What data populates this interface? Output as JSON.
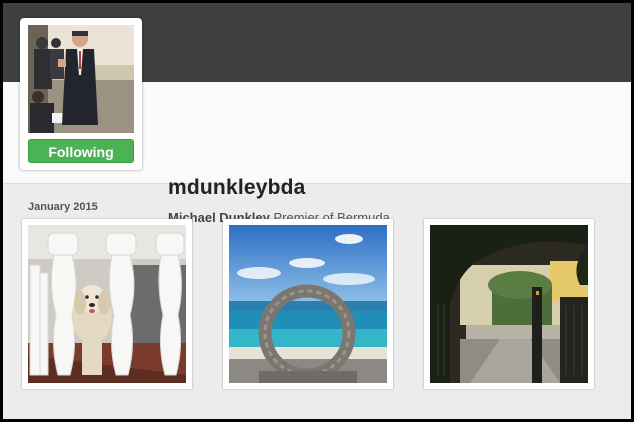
{
  "profile": {
    "username": "mdunkleybda",
    "full_name": "Michael Dunkley",
    "bio": "Premier of Bermuda",
    "follow_label": "Following"
  },
  "feed": {
    "section_label": "January 2015",
    "photos": [
      {
        "subject": "white dog behind porch balusters"
      },
      {
        "subject": "moon gate on beach"
      },
      {
        "subject": "garden gateway at sunset"
      }
    ]
  },
  "colors": {
    "banner": "#3f3f3f",
    "follow_button": "#4cb354",
    "page_background": "#ececec"
  }
}
